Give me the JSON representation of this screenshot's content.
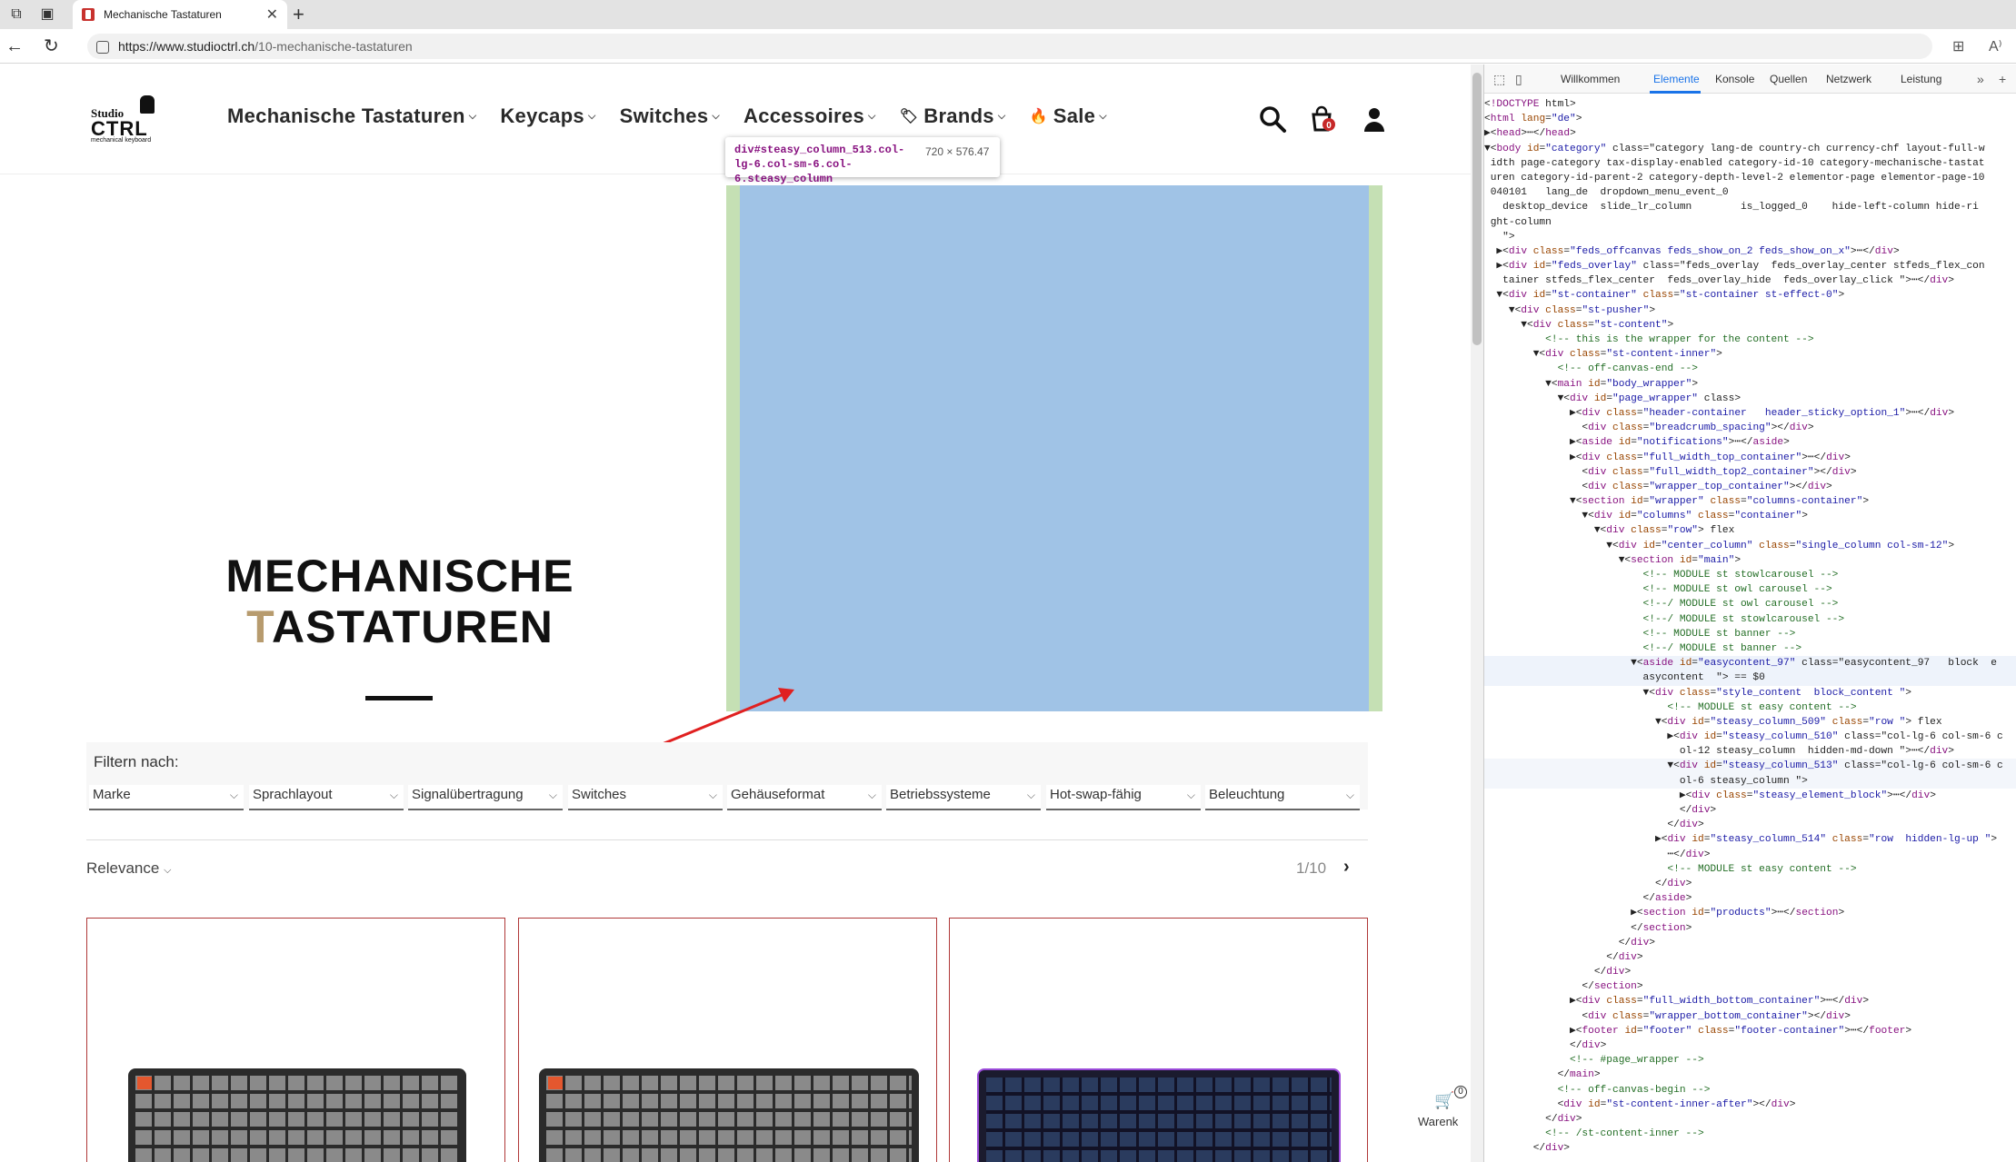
{
  "browser": {
    "tab_title": "Mechanische Tastaturen",
    "url_host": "https://www.studioctrl.ch",
    "url_path": "/10-mechanische-tastaturen"
  },
  "header": {
    "logo": {
      "studio": "Studio",
      "ctrl": "CTRL",
      "sub": "mechanical keyboard"
    },
    "nav": [
      {
        "label": "Mechanische Tastaturen"
      },
      {
        "label": "Keycaps"
      },
      {
        "label": "Switches"
      },
      {
        "label": "Accessoires"
      },
      {
        "label": "Brands"
      },
      {
        "label": "Sale"
      }
    ],
    "cart_count": "0"
  },
  "hero": {
    "title_line1": "MECHANISCHE",
    "title_line2_accent": "T",
    "title_line2_rest": "ASTATUREN"
  },
  "tooltip": {
    "selector": "div#steasy_column_513.col-lg-6.col-sm-6.col-6.steasy_column",
    "dimensions": "720 × 576.47"
  },
  "filter": {
    "label": "Filtern nach:",
    "dropdowns": [
      "Marke",
      "Sprachlayout",
      "Signalübertragung",
      "Switches",
      "Gehäuseformat",
      "Betriebssysteme",
      "Hot-swap-fähig",
      "Beleuchtung"
    ]
  },
  "sort": {
    "label": "Relevance",
    "page": "1/10"
  },
  "side_cart": {
    "label": "Warenk",
    "count": "0"
  },
  "devtools": {
    "tabs": [
      "Willkommen",
      "Elemente",
      "Konsole",
      "Quellen",
      "Netzwerk",
      "Leistung"
    ],
    "lines": [
      "<!DOCTYPE html>",
      "<html lang=\"de\">",
      "▶<head>⋯</head>",
      "▼<body id=\"category\" class=\"category lang-de country-ch currency-chf layout-full-w",
      " idth page-category tax-display-enabled category-id-10 category-mechanische-tastat",
      " uren category-id-parent-2 category-depth-level-2 elementor-page elementor-page-10",
      " 040101   lang_de  dropdown_menu_event_0",
      "   desktop_device  slide_lr_column        is_logged_0    hide-left-column hide-ri",
      " ght-column",
      "   \">",
      "  ▶<div class=\"feds_offcanvas feds_show_on_2 feds_show_on_x\">⋯</div>",
      "  ▶<div id=\"feds_overlay\" class=\"feds_overlay  feds_overlay_center stfeds_flex_con",
      "   tainer stfeds_flex_center  feds_overlay_hide  feds_overlay_click \">⋯</div>",
      "  ▼<div id=\"st-container\" class=\"st-container st-effect-0\">",
      "    ▼<div class=\"st-pusher\">",
      "      ▼<div class=\"st-content\">",
      "          <!-- this is the wrapper for the content -->",
      "        ▼<div class=\"st-content-inner\">",
      "            <!-- off-canvas-end -->",
      "          ▼<main id=\"body_wrapper\">",
      "            ▼<div id=\"page_wrapper\" class>",
      "              ▶<div class=\"header-container   header_sticky_option_1\">⋯</div>",
      "                <div class=\"breadcrumb_spacing\"></div>",
      "              ▶<aside id=\"notifications\">⋯</aside>",
      "              ▶<div class=\"full_width_top_container\">⋯</div>",
      "                <div class=\"full_width_top2_container\"></div>",
      "                <div class=\"wrapper_top_container\"></div>",
      "              ▼<section id=\"wrapper\" class=\"columns-container\">",
      "                ▼<div id=\"columns\" class=\"container\">",
      "                  ▼<div class=\"row\"> flex",
      "                    ▼<div id=\"center_column\" class=\"single_column col-sm-12\">",
      "                      ▼<section id=\"main\">",
      "                          <!-- MODULE st stowlcarousel -->",
      "                          <!-- MODULE st owl carousel -->",
      "                          <!--/ MODULE st owl carousel -->",
      "                          <!--/ MODULE st stowlcarousel -->",
      "                          <!-- MODULE st banner -->",
      "                          <!--/ MODULE st banner -->",
      "                        ▼<aside id=\"easycontent_97\" class=\"easycontent_97   block  e",
      "                          asycontent  \"> == $0",
      "                          ▼<div class=\"style_content  block_content \">",
      "                              <!-- MODULE st easy content -->",
      "                            ▼<div id=\"steasy_column_509\" class=\"row \"> flex",
      "                              ▶<div id=\"steasy_column_510\" class=\"col-lg-6 col-sm-6 c",
      "                                ol-12 steasy_column  hidden-md-down \">⋯</div>",
      "                              ▼<div id=\"steasy_column_513\" class=\"col-lg-6 col-sm-6 c",
      "                                ol-6 steasy_column \">",
      "                                ▶<div class=\"steasy_element_block\">⋯</div>",
      "                                </div>",
      "                              </div>",
      "                            ▶<div id=\"steasy_column_514\" class=\"row  hidden-lg-up \">",
      "                              ⋯</div>",
      "                              <!-- MODULE st easy content -->",
      "                            </div>",
      "                          </aside>",
      "                        ▶<section id=\"products\">⋯</section>",
      "                        </section>",
      "                      </div>",
      "                    </div>",
      "                  </div>",
      "                </section>",
      "              ▶<div class=\"full_width_bottom_container\">⋯</div>",
      "                <div class=\"wrapper_bottom_container\"></div>",
      "              ▶<footer id=\"footer\" class=\"footer-container\">⋯</footer>",
      "              </div>",
      "              <!-- #page_wrapper -->",
      "            </main>",
      "            <!-- off-canvas-begin -->",
      "            <div id=\"st-content-inner-after\"></div>",
      "          </div>",
      "          <!-- /st-content-inner -->",
      "        </div>"
    ]
  }
}
